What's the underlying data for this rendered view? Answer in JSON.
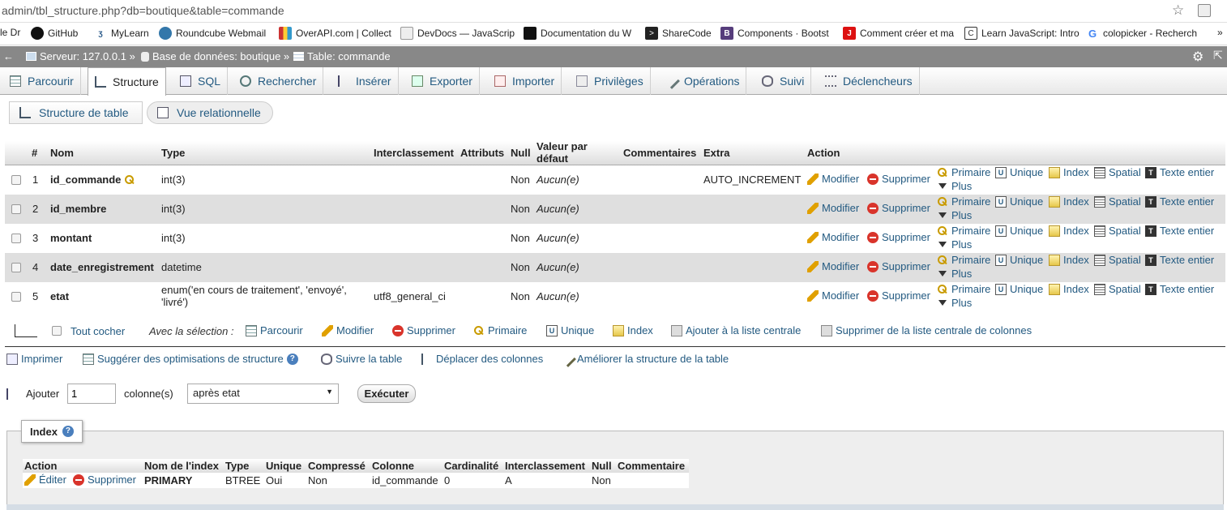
{
  "browser": {
    "url_prefix": "admin/tbl_structure.php?db=boutique&table=commande",
    "bookmarks": [
      {
        "label": "le Dr",
        "icon": "drive-icon"
      },
      {
        "label": "GitHub",
        "icon": "github-icon"
      },
      {
        "label": "MyLearn",
        "icon": "mylearn-icon"
      },
      {
        "label": "Roundcube Webmail",
        "icon": "roundcube-icon"
      },
      {
        "label": "OverAPI.com | Collect",
        "icon": "overapi-icon"
      },
      {
        "label": "DevDocs — JavaScrip",
        "icon": "devdocs-icon"
      },
      {
        "label": "Documentation du W",
        "icon": "documentation-icon"
      },
      {
        "label": "ShareCode",
        "icon": "sharecode-icon"
      },
      {
        "label": "Components · Bootst",
        "icon": "bootstrap-icon"
      },
      {
        "label": "Comment créer et ma",
        "icon": "comment-icon"
      },
      {
        "label": "Learn JavaScript: Intro",
        "icon": "learnjs-icon"
      },
      {
        "label": "colopicker - Recherch",
        "icon": "google-icon"
      }
    ],
    "more": "»"
  },
  "breadcrumb": {
    "server": "Serveur: 127.0.0.1 »",
    "database": "Base de données: boutique »",
    "table": "Table: commande"
  },
  "tabs": [
    {
      "label": "Parcourir",
      "icon": "browse-icon"
    },
    {
      "label": "Structure",
      "icon": "structure-icon"
    },
    {
      "label": "SQL",
      "icon": "sql-icon"
    },
    {
      "label": "Rechercher",
      "icon": "search-icon"
    },
    {
      "label": "Insérer",
      "icon": "insert-icon"
    },
    {
      "label": "Exporter",
      "icon": "export-icon"
    },
    {
      "label": "Importer",
      "icon": "import-icon"
    },
    {
      "label": "Privilèges",
      "icon": "privileges-icon"
    },
    {
      "label": "Opérations",
      "icon": "wrench-icon"
    },
    {
      "label": "Suivi",
      "icon": "eye-icon"
    },
    {
      "label": "Déclencheurs",
      "icon": "triggers-icon"
    }
  ],
  "subnav": {
    "structure": "Structure de table",
    "relational": "Vue relationnelle"
  },
  "table": {
    "headers": [
      "#",
      "Nom",
      "Type",
      "Interclassement",
      "Attributs",
      "Null",
      "Valeur par",
      "défaut",
      "Commentaires",
      "Extra",
      "Action"
    ],
    "rows": [
      {
        "num": "1",
        "name": "id_commande",
        "type": "int(3)",
        "type2": "",
        "collation": "",
        "null": "Non",
        "default": "Aucun(e)",
        "extra": "AUTO_INCREMENT"
      },
      {
        "num": "2",
        "name": "id_membre",
        "type": "int(3)",
        "type2": "",
        "collation": "",
        "null": "Non",
        "default": "Aucun(e)",
        "extra": ""
      },
      {
        "num": "3",
        "name": "montant",
        "type": "int(3)",
        "type2": "",
        "collation": "",
        "null": "Non",
        "default": "Aucun(e)",
        "extra": ""
      },
      {
        "num": "4",
        "name": "date_enregistrement",
        "type": "datetime",
        "type2": "",
        "collation": "",
        "null": "Non",
        "default": "Aucun(e)",
        "extra": ""
      },
      {
        "num": "5",
        "name": "etat",
        "type": "enum('en cours de traitement', 'envoyé',",
        "type2": "'livré')",
        "collation": "utf8_general_ci",
        "null": "Non",
        "default": "Aucun(e)",
        "extra": ""
      }
    ],
    "row_actions": {
      "modify": "Modifier",
      "delete": "Supprimer",
      "primary": "Primaire",
      "unique": "Unique",
      "index": "Index",
      "spatial": "Spatial",
      "fulltext": "Texte entier",
      "more": "Plus"
    }
  },
  "selection_bar": {
    "check_all": "Tout cocher",
    "with_selection": "Avec la sélection :",
    "browse": "Parcourir",
    "modify": "Modifier",
    "delete": "Supprimer",
    "primary": "Primaire",
    "unique": "Unique",
    "index": "Index",
    "add_central": "Ajouter à la liste centrale",
    "remove_central": "Supprimer de la liste centrale de colonnes"
  },
  "tools": {
    "print": "Imprimer",
    "suggest": "Suggérer des optimisations de structure",
    "track": "Suivre la table",
    "move": "Déplacer des colonnes",
    "improve": "Améliorer la structure de la table"
  },
  "add_columns": {
    "label": "Ajouter",
    "count": "1",
    "unit": "colonne(s)",
    "position": "après etat",
    "execute": "Exécuter"
  },
  "indexes": {
    "legend": "Index",
    "headers": [
      "Action",
      "Nom de l'index",
      "Type",
      "Unique",
      "Compressé",
      "Colonne",
      "Cardinalité",
      "Interclassement",
      "Null",
      "Commentaire"
    ],
    "row": {
      "edit": "Éditer",
      "delete": "Supprimer",
      "name": "PRIMARY",
      "type": "BTREE",
      "unique": "Oui",
      "compressed": "Non",
      "column": "id_commande",
      "cardinality": "0",
      "collation": "A",
      "null": "Non",
      "comment": ""
    }
  }
}
